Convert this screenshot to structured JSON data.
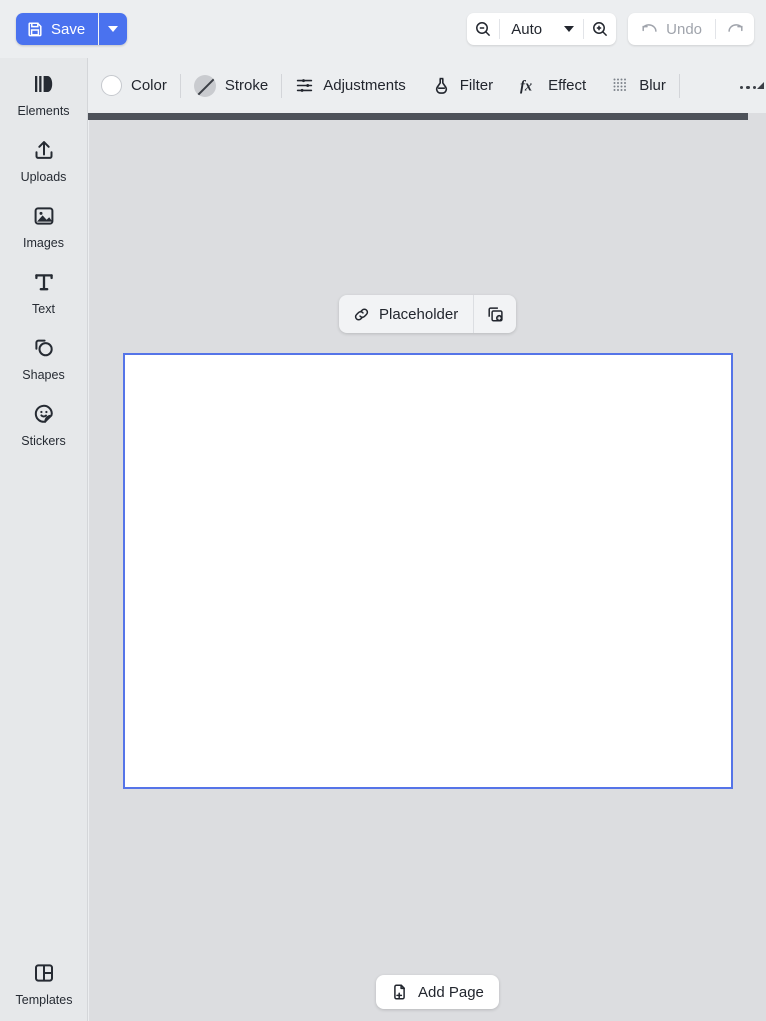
{
  "topbar": {
    "save_label": "Save",
    "save_icon": "floppy-disk-icon",
    "save_caret_icon": "chevron-down-icon",
    "zoom_out_icon": "magnifier-minus-icon",
    "zoom_value": "Auto",
    "zoom_caret_icon": "chevron-down-icon",
    "zoom_in_icon": "magnifier-plus-icon",
    "undo_label": "Undo",
    "undo_icon": "undo-arrow-icon",
    "redo_icon": "redo-arrow-icon",
    "accent_color": "#4a72ef",
    "disabled_color": "#a0a4ac"
  },
  "sidebar": {
    "items": [
      {
        "label": "Elements",
        "icon": "elements-icon"
      },
      {
        "label": "Uploads",
        "icon": "upload-icon"
      },
      {
        "label": "Images",
        "icon": "image-icon"
      },
      {
        "label": "Text",
        "icon": "text-t-icon"
      },
      {
        "label": "Shapes",
        "icon": "shapes-icon"
      },
      {
        "label": "Stickers",
        "icon": "sticker-smiley-icon"
      }
    ],
    "bottom_item": {
      "label": "Templates",
      "icon": "templates-layout-icon"
    }
  },
  "context_toolbar": {
    "items": [
      {
        "label": "Color",
        "icon": "color-swatch-circle"
      },
      {
        "label": "Stroke",
        "icon": "stroke-none-icon"
      },
      {
        "label": "Adjustments",
        "icon": "sliders-icon"
      },
      {
        "label": "Filter",
        "icon": "flask-icon"
      },
      {
        "label": "Effect",
        "icon": "fx-icon"
      },
      {
        "label": "Blur",
        "icon": "blur-dots-icon"
      }
    ],
    "overflow_icon": "more-options-icon"
  },
  "workspace": {
    "placeholder": {
      "label": "Placeholder",
      "link_icon": "link-chain-icon",
      "duplicate_icon": "duplicate-plus-icon"
    },
    "canvas": {
      "selection_color": "#5574e8",
      "fill_color": "#ffffff"
    },
    "add_page": {
      "label": "Add Page",
      "icon": "page-plus-icon"
    },
    "background_color": "#dcdde0"
  }
}
